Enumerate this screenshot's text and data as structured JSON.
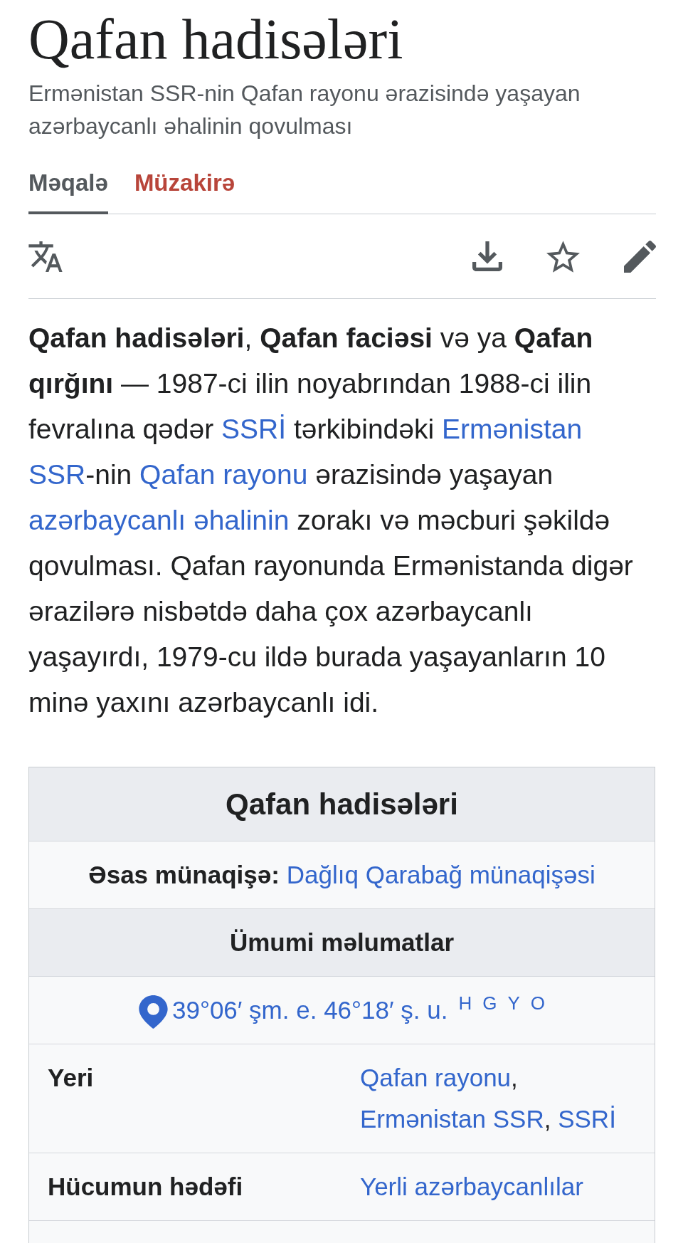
{
  "page": {
    "title": "Qafan hadisələri",
    "description": "Ermənistan SSR-nin Qafan rayonu ərazisində yaşayan azərbaycanlı əhalinin qovulması"
  },
  "tabs": [
    {
      "label": "Məqalə",
      "selected": true,
      "page_exists": true
    },
    {
      "label": "Müzakirə",
      "selected": false,
      "page_exists": false
    }
  ],
  "article": {
    "segments": [
      {
        "kind": "text",
        "text": "**Qafan hadisələri**, **Qafan faciəsi** və ya **Qafan qırğını** — 1987-ci ilin noyabrından 1988-ci ilin fevralına qədər "
      },
      {
        "kind": "link",
        "text": "SSRİ"
      },
      {
        "kind": "text",
        "text": " tərkibindəki "
      },
      {
        "kind": "link",
        "text": "Ermənistan"
      },
      {
        "kind": "link",
        "text": "SSR"
      },
      {
        "kind": "text",
        "text": "-nin "
      },
      {
        "kind": "link",
        "text": "Qafan rayonu"
      },
      {
        "kind": "text",
        "text": " ərazisində yaşayan "
      },
      {
        "kind": "link",
        "text": "azərbaycanlı əhalinin"
      },
      {
        "kind": "text",
        "text": " zorakı və məcburi şəkildə qovulması. Qafan rayonunda Ermənistanda digər ərazilərə nisbətdə daha çox azərbaycanlı yaşayırdı, 1979-cu ildə burada yaşayanların 10 minə yaxını azərbaycanlı idi."
      }
    ]
  },
  "infobox": {
    "title": "Qafan hadisələri",
    "rows": [
      {
        "kind": "note",
        "label": "Əsas münaqişə:",
        "value": [
          {
            "kind": "link",
            "text": "Dağlıq Qarabağ münaqişəsi"
          }
        ]
      },
      {
        "kind": "section",
        "label": "Ümumi məlumatlar"
      },
      {
        "kind": "coordinates",
        "value": [
          {
            "kind": "link",
            "text": "39°06′ şm. e. 46°18′ ş. u."
          }
        ],
        "map_links": [
          "H",
          "G",
          "Y",
          "O"
        ]
      },
      {
        "kind": "field",
        "label": "Yeri",
        "value": [
          {
            "kind": "link",
            "text": "Qafan rayonu"
          },
          {
            "kind": "text",
            "text": ", "
          },
          {
            "kind": "link",
            "text": "Ermənistan SSR"
          },
          {
            "kind": "text",
            "text": ", "
          },
          {
            "kind": "link",
            "text": "SSRİ"
          }
        ]
      },
      {
        "kind": "field",
        "label": "Hücumun hədəfi",
        "value": [
          {
            "kind": "link",
            "text": "Yerli azərbaycanlılar"
          }
        ]
      }
    ]
  }
}
